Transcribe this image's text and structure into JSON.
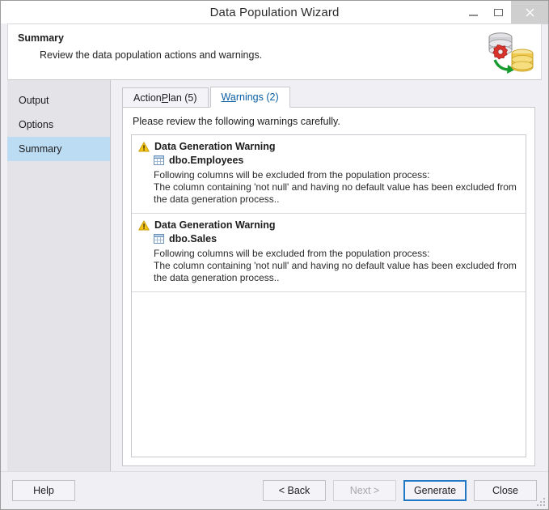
{
  "window": {
    "title": "Data Population Wizard",
    "controls": [
      {
        "name": "minimize",
        "label": "–"
      },
      {
        "name": "maximize",
        "label": "□"
      },
      {
        "name": "close",
        "label": "×"
      }
    ]
  },
  "header": {
    "title": "Summary",
    "subtitle": "Review the data population actions and warnings.",
    "icon": "database-generation-icon"
  },
  "sidebar": {
    "items": [
      {
        "label": "Output",
        "active": false
      },
      {
        "label": "Options",
        "active": false
      },
      {
        "label": "Summary",
        "active": true
      }
    ]
  },
  "tabs": [
    {
      "label": "Action Plan (5)",
      "accel_prefix": "Action ",
      "accel_char": "P",
      "accel_suffix": "lan (5)",
      "active": false
    },
    {
      "label": "Warnings (2)",
      "accel_prefix": "",
      "accel_char": "Wa",
      "accel_suffix": "rnings (2)",
      "active": true
    }
  ],
  "panel": {
    "intro": "Please review the following warnings carefully.",
    "warnings": [
      {
        "icon": "warning-triangle-icon",
        "title": "Data Generation Warning",
        "object_icon": "table-icon",
        "object_name": "dbo.Employees",
        "line1": "Following columns will be excluded from the population process:",
        "line2": "The column containing 'not null' and having no default value has been excluded from the data generation process.."
      },
      {
        "icon": "warning-triangle-icon",
        "title": "Data Generation Warning",
        "object_icon": "table-icon",
        "object_name": "dbo.Sales",
        "line1": "Following columns will be excluded from the population process:",
        "line2": "The column containing 'not null' and having no default value has been excluded from the data generation process.."
      }
    ]
  },
  "footer": {
    "help": "Help",
    "back": "< Back",
    "next": "Next >",
    "generate": "Generate",
    "close": "Close"
  },
  "colors": {
    "accent": "#2179c6",
    "sidebar_active": "#bcdcf4",
    "tab_active_text": "#0b5fa4",
    "warning_yellow": "#f5c518",
    "db_target": "#efc94c",
    "arrow_green": "#159b2e"
  }
}
